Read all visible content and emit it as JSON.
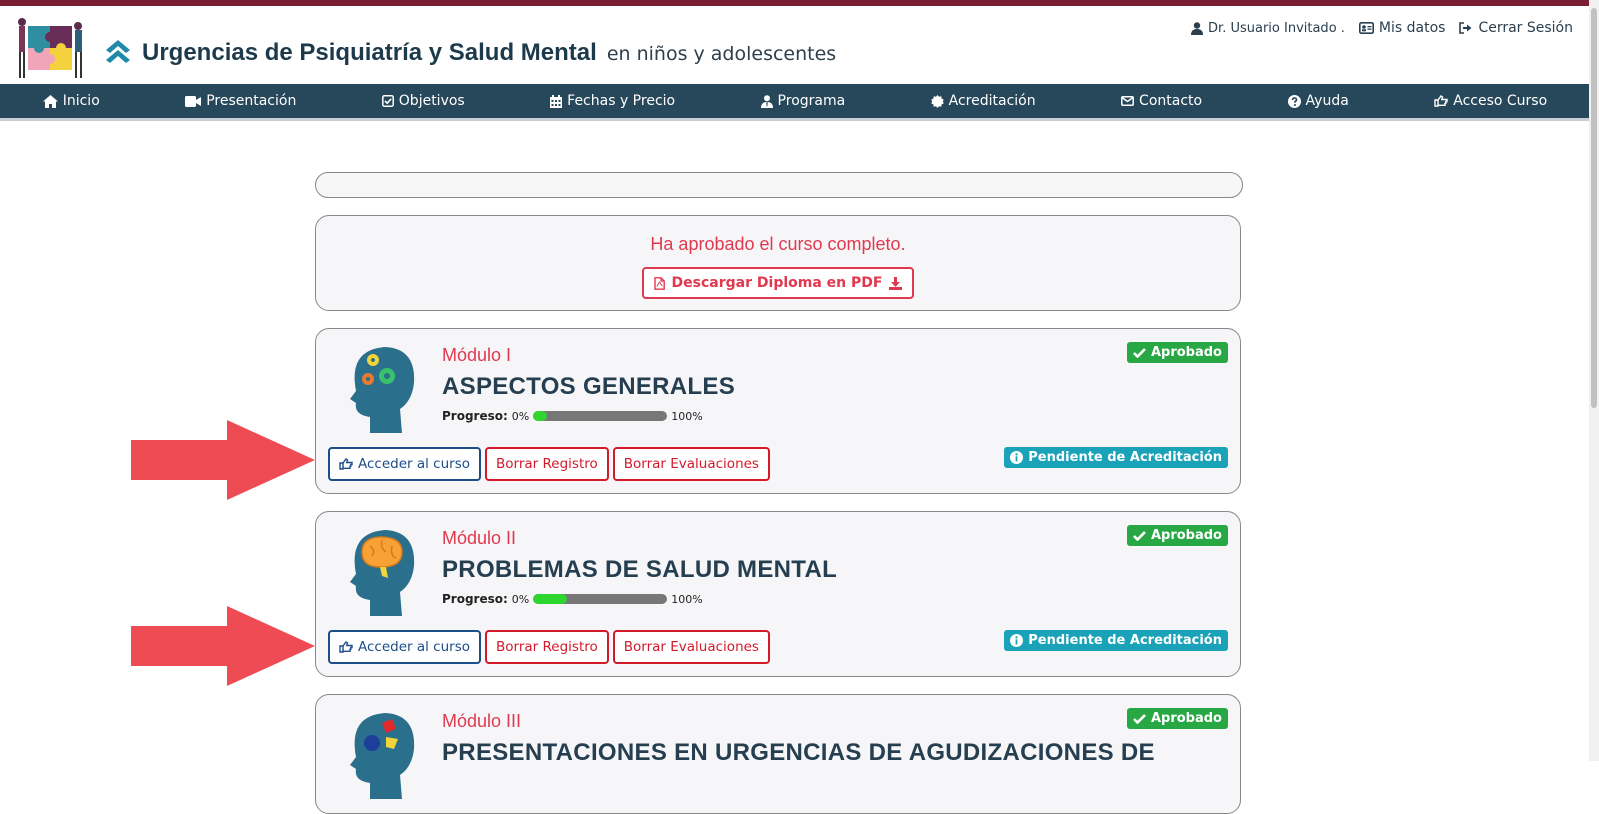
{
  "header": {
    "title": "Urgencias de Psiquiatría y Salud Mental",
    "subtitle": "en niños y adolescentes",
    "user": "Dr. Usuario Invitado .",
    "mis_datos": "Mis datos",
    "cerrar_sesion": "Cerrar Sesión",
    "icons": [
      "user-icon",
      "id-card-icon",
      "sign-out-icon",
      "chevron-up-icon"
    ]
  },
  "nav": [
    {
      "label": "Inicio",
      "icon": "home-icon"
    },
    {
      "label": "Presentación",
      "icon": "video-icon"
    },
    {
      "label": "Objetivos",
      "icon": "check-square-icon"
    },
    {
      "label": "Fechas y Precio",
      "icon": "calendar-icon"
    },
    {
      "label": "Programa",
      "icon": "user-tie-icon"
    },
    {
      "label": "Acreditación",
      "icon": "certificate-icon"
    },
    {
      "label": "Contacto",
      "icon": "envelope-icon"
    },
    {
      "label": "Ayuda",
      "icon": "question-circle-icon"
    },
    {
      "label": "Acceso Curso",
      "icon": "hand-point-icon"
    }
  ],
  "diploma": {
    "message": "Ha aprobado el curso completo.",
    "button": "Descargar Diploma en PDF"
  },
  "modules": [
    {
      "number": "Módulo I",
      "title": "ASPECTOS GENERALES",
      "progress_label": "Progreso:",
      "progress_min": "0%",
      "progress_max": "100%",
      "progress_value": 0.1,
      "status": "Aprobado",
      "accreditation": "Pendiente de Acreditación",
      "buttons": {
        "access": "Acceder al curso",
        "clear_record": "Borrar Registro",
        "clear_evals": "Borrar Evaluaciones"
      }
    },
    {
      "number": "Módulo II",
      "title": "PROBLEMAS DE SALUD MENTAL",
      "progress_label": "Progreso:",
      "progress_min": "0%",
      "progress_max": "100%",
      "progress_value": 0.25,
      "status": "Aprobado",
      "accreditation": "Pendiente de Acreditación",
      "buttons": {
        "access": "Acceder al curso",
        "clear_record": "Borrar Registro",
        "clear_evals": "Borrar Evaluaciones"
      }
    },
    {
      "number": "Módulo III",
      "title": "PRESENTACIONES EN URGENCIAS DE AGUDIZACIONES DE",
      "status": "Aprobado"
    }
  ],
  "colors": {
    "nav_bg": "#27475a",
    "accent_red": "#e0394f",
    "approved_green": "#28a745",
    "pending_teal": "#1aa2b8",
    "arrow_red": "#ee4b55",
    "progress_green": "#2fd62f"
  }
}
